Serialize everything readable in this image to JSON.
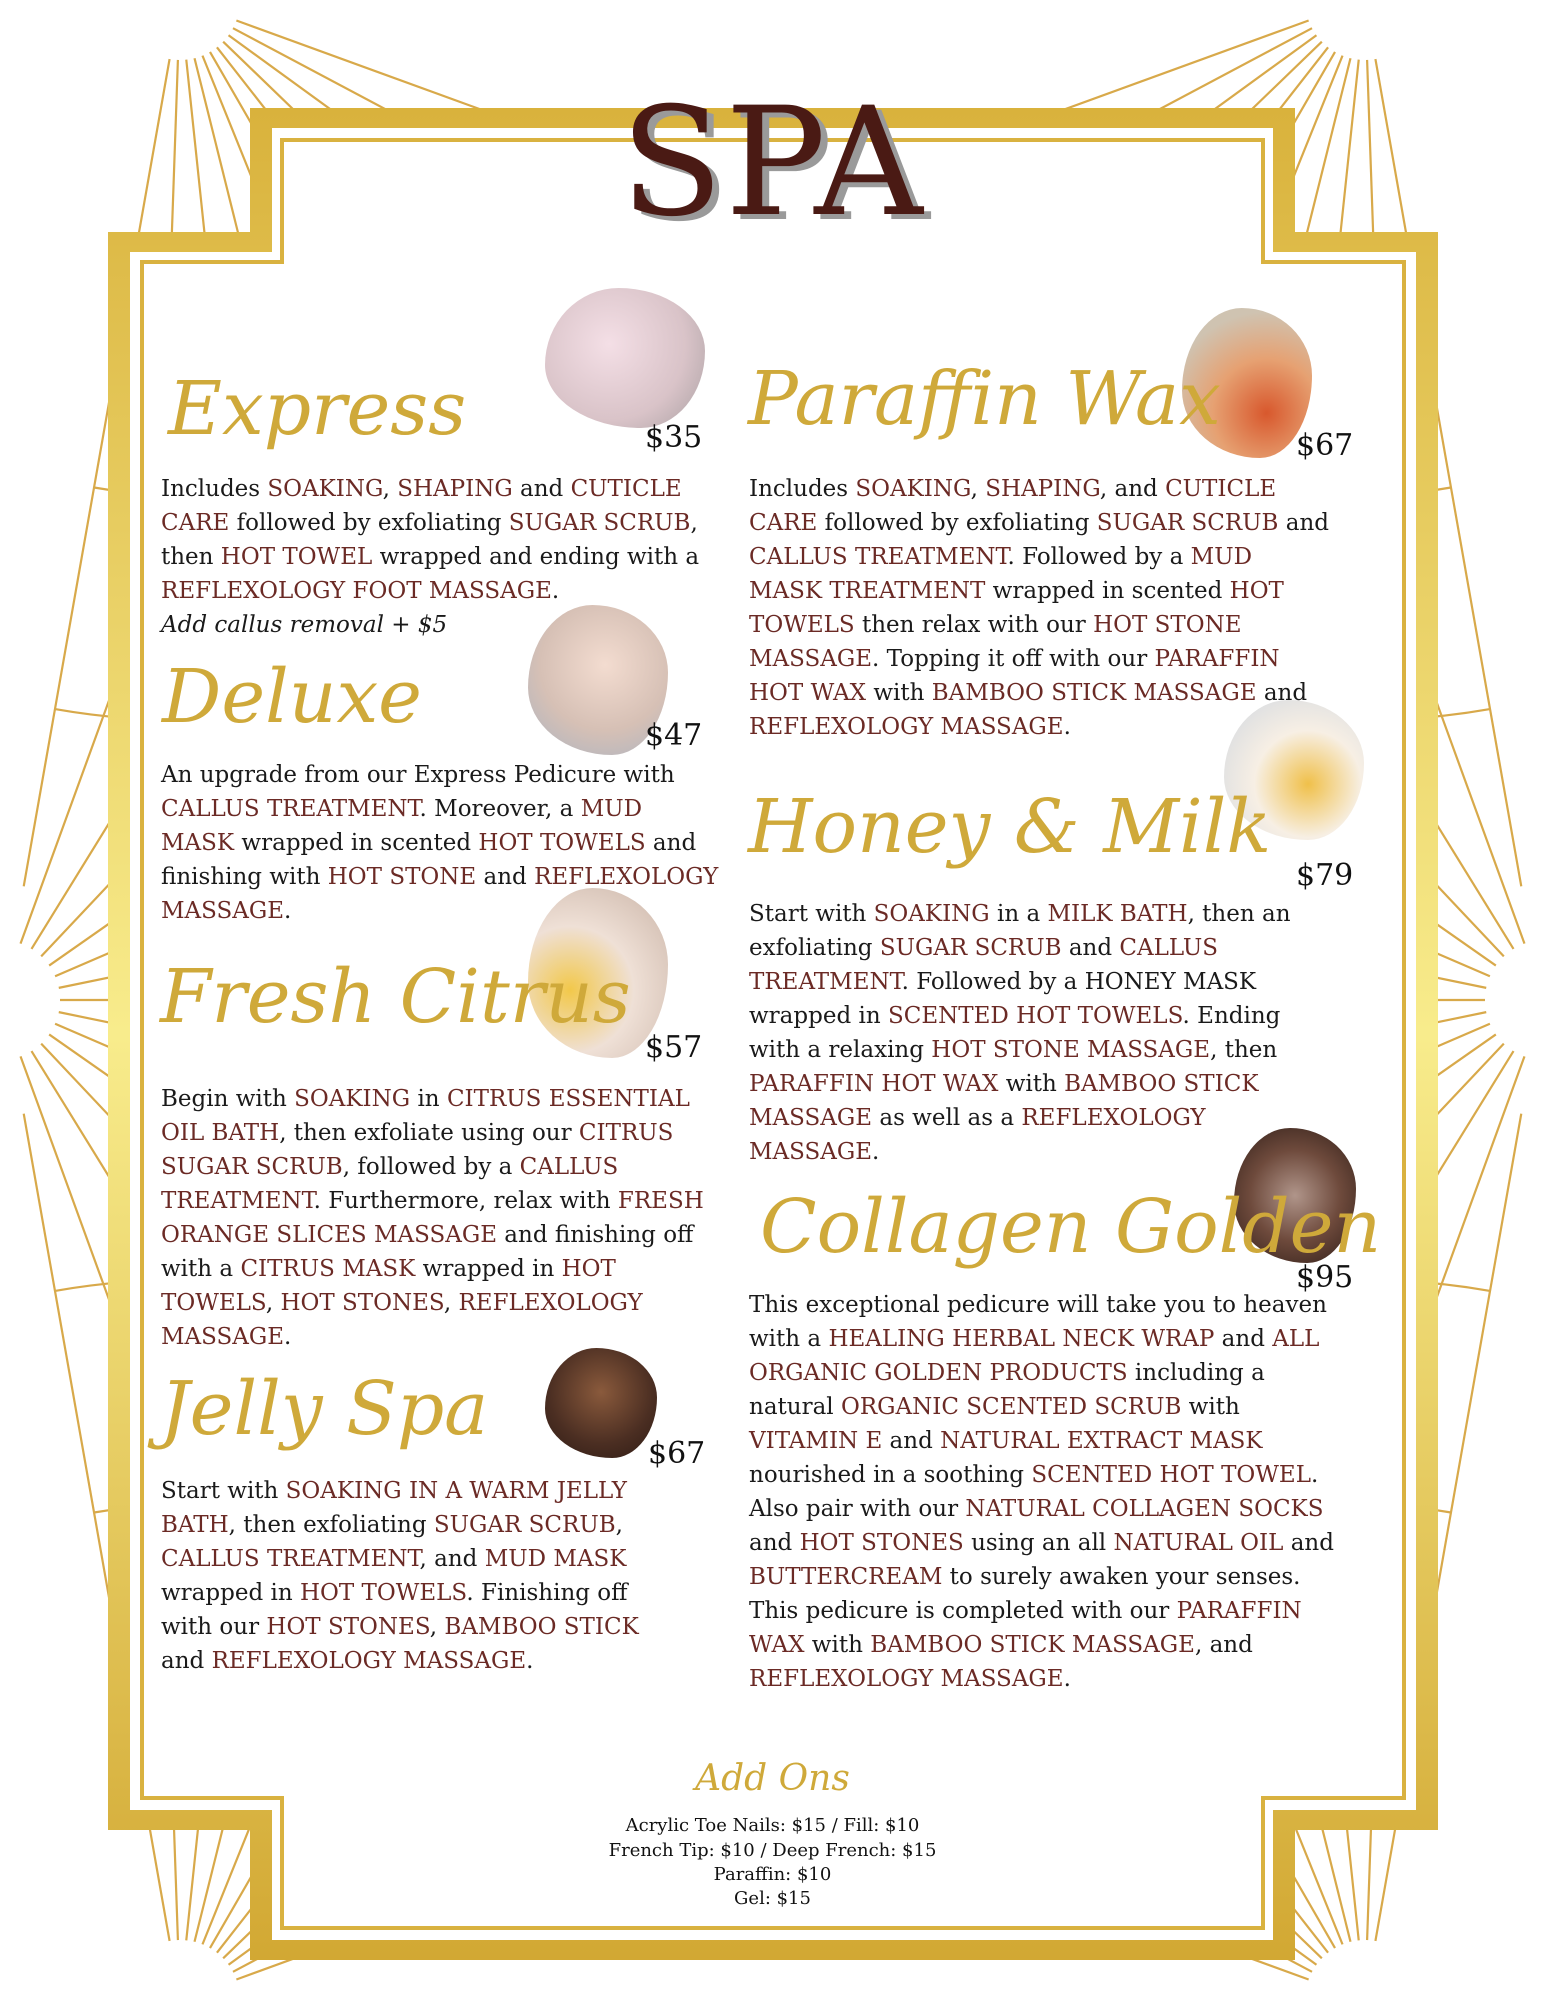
{
  "title": "SPA",
  "colors": {
    "gold": "#d4ad3c",
    "gold_light": "#f7e987",
    "maroon": "#4a1a14",
    "highlight": "#6b2a25"
  },
  "services": [
    {
      "id": "express",
      "name": "Express",
      "price": "$35",
      "image": "foot-soak-photo",
      "description": [
        {
          "t": "Includes "
        },
        {
          "t": "SOAKING",
          "hl": true
        },
        {
          "t": ", "
        },
        {
          "t": "SHAPING",
          "hl": true
        },
        {
          "t": " and "
        },
        {
          "t": "CUTICLE CARE",
          "hl": true
        },
        {
          "t": " followed by exfoliating "
        },
        {
          "t": "SUGAR SCRUB",
          "hl": true
        },
        {
          "t": ", then "
        },
        {
          "t": "HOT TOWEL",
          "hl": true
        },
        {
          "t": " wrapped and ending with a "
        },
        {
          "t": "REFLEXOLOGY FOOT MASSAGE",
          "hl": true
        },
        {
          "t": "."
        }
      ],
      "note": "Add callus removal + $5"
    },
    {
      "id": "deluxe",
      "name": "Deluxe",
      "price": "$47",
      "image": "foot-care-photo",
      "description": [
        {
          "t": "An upgrade from our Express Pedicure with "
        },
        {
          "t": "CALLUS TREATMENT",
          "hl": true
        },
        {
          "t": ". Moreover, a "
        },
        {
          "t": "MUD MASK",
          "hl": true
        },
        {
          "t": " wrapped in scented "
        },
        {
          "t": "HOT TOWELS",
          "hl": true
        },
        {
          "t": " and finishing with "
        },
        {
          "t": "HOT STONE",
          "hl": true
        },
        {
          "t": " and "
        },
        {
          "t": "REFLEXOLOGY MASSAGE",
          "hl": true
        },
        {
          "t": "."
        }
      ]
    },
    {
      "id": "fresh-citrus",
      "name": "Fresh Citrus",
      "price": "$57",
      "image": "citrus-scrub-photo",
      "description": [
        {
          "t": "Begin with "
        },
        {
          "t": "SOAKING",
          "hl": true
        },
        {
          "t": " in "
        },
        {
          "t": "CITRUS ESSENTIAL OIL BATH",
          "hl": true
        },
        {
          "t": ", then exfoliate using our "
        },
        {
          "t": "CITRUS SUGAR SCRUB",
          "hl": true
        },
        {
          "t": ", followed by a "
        },
        {
          "t": "CALLUS TREATMENT",
          "hl": true
        },
        {
          "t": ". Furthermore, relax with "
        },
        {
          "t": "FRESH ORANGE SLICES MASSAGE",
          "hl": true
        },
        {
          "t": " and finishing off with a "
        },
        {
          "t": "CITRUS MASK",
          "hl": true
        },
        {
          "t": " wrapped in "
        },
        {
          "t": "HOT TOWELS",
          "hl": true
        },
        {
          "t": ", "
        },
        {
          "t": "HOT STONES",
          "hl": true
        },
        {
          "t": ", "
        },
        {
          "t": "REFLEXOLOGY MASSAGE",
          "hl": true
        },
        {
          "t": "."
        }
      ]
    },
    {
      "id": "jelly-spa",
      "name": "Jelly Spa",
      "price": "$67",
      "image": "jelly-spa-photo",
      "description": [
        {
          "t": "Start with "
        },
        {
          "t": "SOAKING IN A WARM JELLY BATH",
          "hl": true
        },
        {
          "t": ", then exfoliating "
        },
        {
          "t": "SUGAR SCRUB",
          "hl": true
        },
        {
          "t": ", "
        },
        {
          "t": "CALLUS TREATMENT",
          "hl": true
        },
        {
          "t": ", and "
        },
        {
          "t": "MUD MASK",
          "hl": true
        },
        {
          "t": " wrapped in "
        },
        {
          "t": "HOT TOWELS",
          "hl": true
        },
        {
          "t": ". Finishing off with our "
        },
        {
          "t": "HOT STONES",
          "hl": true
        },
        {
          "t": ", "
        },
        {
          "t": "BAMBOO STICK",
          "hl": true
        },
        {
          "t": " and "
        },
        {
          "t": "REFLEXOLOGY MASSAGE",
          "hl": true
        },
        {
          "t": "."
        }
      ]
    },
    {
      "id": "paraffin-wax",
      "name": "Paraffin Wax",
      "price": "$67",
      "image": "paraffin-wax-photo",
      "description": [
        {
          "t": "Includes "
        },
        {
          "t": "SOAKING",
          "hl": true
        },
        {
          "t": ", "
        },
        {
          "t": "SHAPING",
          "hl": true
        },
        {
          "t": ", and "
        },
        {
          "t": "CUTICLE CARE",
          "hl": true
        },
        {
          "t": " followed by exfoliating "
        },
        {
          "t": "SUGAR SCRUB",
          "hl": true
        },
        {
          "t": " and "
        },
        {
          "t": "CALLUS TREATMENT",
          "hl": true
        },
        {
          "t": ". Followed by a "
        },
        {
          "t": "MUD MASK TREATMENT",
          "hl": true
        },
        {
          "t": " wrapped in scented "
        },
        {
          "t": "HOT TOWELS",
          "hl": true
        },
        {
          "t": " then relax with our "
        },
        {
          "t": "HOT STONE MASSAGE",
          "hl": true
        },
        {
          "t": ". Topping it off with our "
        },
        {
          "t": "PARAFFIN HOT WAX",
          "hl": true
        },
        {
          "t": " with "
        },
        {
          "t": "BAMBOO STICK MASSAGE",
          "hl": true
        },
        {
          "t": " and "
        },
        {
          "t": "REFLEXOLOGY MASSAGE",
          "hl": true
        },
        {
          "t": "."
        }
      ]
    },
    {
      "id": "honey-milk",
      "name": "Honey & Milk",
      "price": "$79",
      "image": "honey-milk-photo",
      "description": [
        {
          "t": "Start with "
        },
        {
          "t": "SOAKING",
          "hl": true
        },
        {
          "t": " in a "
        },
        {
          "t": "MILK BATH",
          "hl": true
        },
        {
          "t": ", then an exfoliating "
        },
        {
          "t": "SUGAR SCRUB",
          "hl": true
        },
        {
          "t": " and "
        },
        {
          "t": "CALLUS TREATMENT",
          "hl": true
        },
        {
          "t": ". Followed by a HONEY MASK wrapped in "
        },
        {
          "t": "SCENTED HOT TOWELS",
          "hl": true
        },
        {
          "t": ". Ending with a relaxing "
        },
        {
          "t": "HOT STONE MASSAGE",
          "hl": true
        },
        {
          "t": ", then "
        },
        {
          "t": "PARAFFIN HOT WAX",
          "hl": true
        },
        {
          "t": " with "
        },
        {
          "t": "BAMBOO STICK MASSAGE",
          "hl": true
        },
        {
          "t": " as well as a "
        },
        {
          "t": "REFLEXOLOGY MASSAGE",
          "hl": true
        },
        {
          "t": "."
        }
      ]
    },
    {
      "id": "collagen-golden",
      "name": "Collagen Golden",
      "price": "$95",
      "image": "collagen-golden-photo",
      "description": [
        {
          "t": "This exceptional pedicure will take you to heaven with a "
        },
        {
          "t": "HEALING HERBAL NECK WRAP",
          "hl": true
        },
        {
          "t": " and "
        },
        {
          "t": "ALL ORGANIC GOLDEN PRODUCTS",
          "hl": true
        },
        {
          "t": " including a natural "
        },
        {
          "t": "ORGANIC SCENTED SCRUB",
          "hl": true
        },
        {
          "t": " with "
        },
        {
          "t": "VITAMIN E",
          "hl": true
        },
        {
          "t": " and "
        },
        {
          "t": "NATURAL EXTRACT MASK",
          "hl": true
        },
        {
          "t": " nourished in a soothing "
        },
        {
          "t": "SCENTED HOT TOWEL",
          "hl": true
        },
        {
          "t": ". Also pair with our "
        },
        {
          "t": "NATURAL COLLAGEN SOCKS",
          "hl": true
        },
        {
          "t": " and "
        },
        {
          "t": "HOT STONES",
          "hl": true
        },
        {
          "t": " using an all "
        },
        {
          "t": "NATURAL OIL",
          "hl": true
        },
        {
          "t": " and "
        },
        {
          "t": "BUTTERCREAM",
          "hl": true
        },
        {
          "t": " to surely awaken your senses. This pedicure is completed with our "
        },
        {
          "t": "PARAFFIN WAX",
          "hl": true
        },
        {
          "t": " with "
        },
        {
          "t": "BAMBOO STICK MASSAGE",
          "hl": true
        },
        {
          "t": ", and "
        },
        {
          "t": "REFLEXOLOGY MASSAGE",
          "hl": true
        },
        {
          "t": "."
        }
      ]
    }
  ],
  "addons": {
    "title": "Add Ons",
    "items": [
      "Acrylic Toe Nails: $15 / Fill: $10",
      "French Tip: $10  / Deep French: $15",
      "Paraffin: $10",
      "Gel: $15"
    ]
  }
}
